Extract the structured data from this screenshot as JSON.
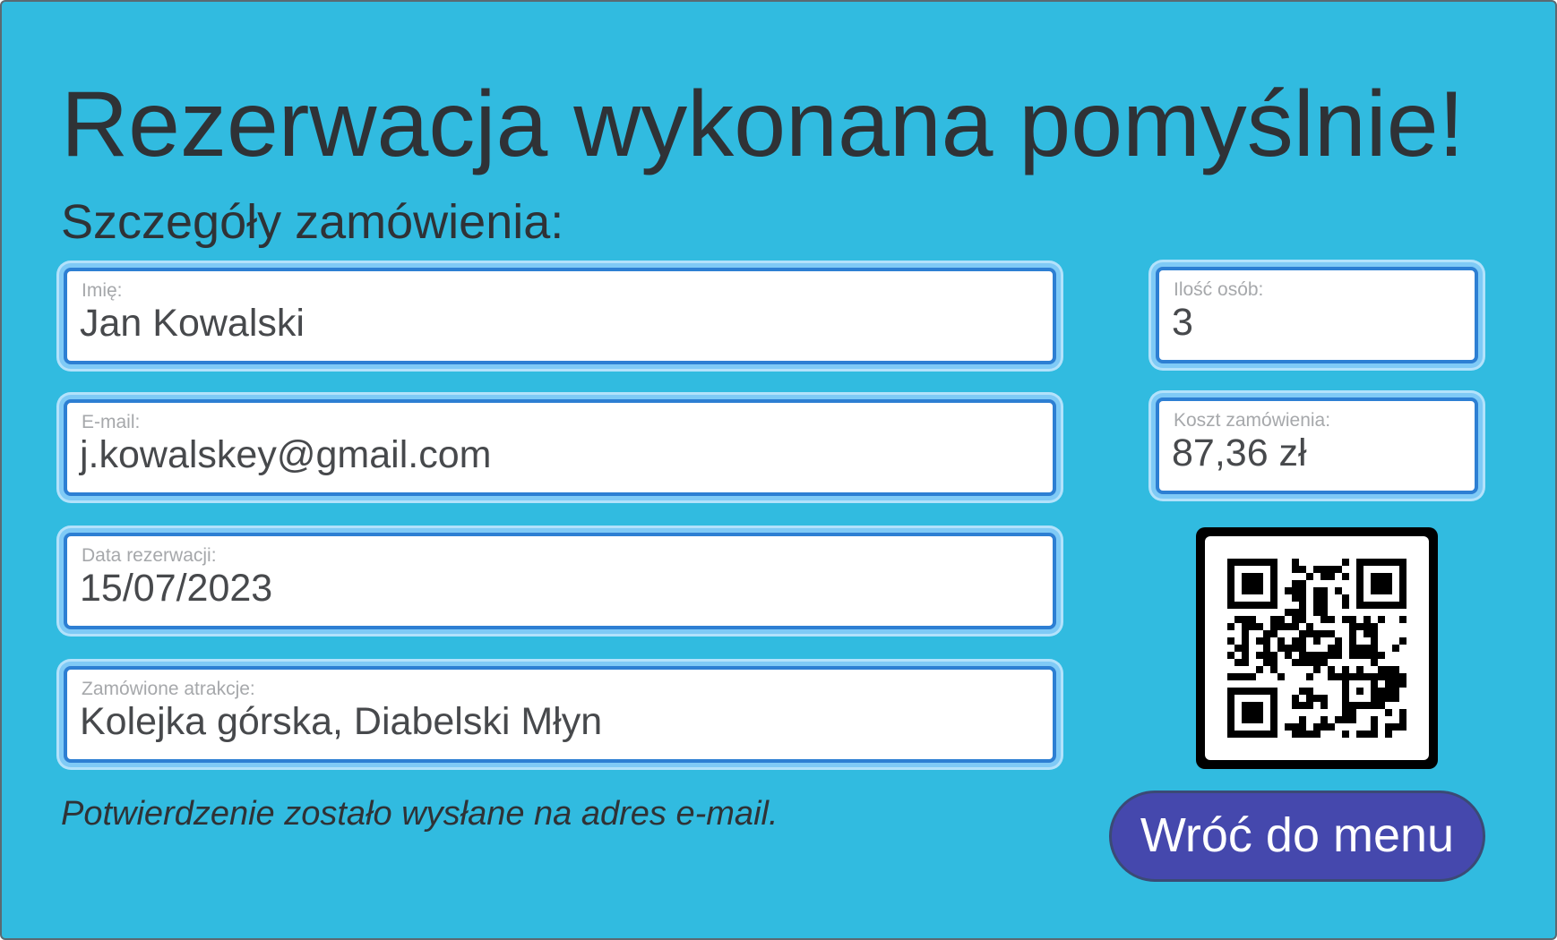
{
  "page": {
    "title": "Rezerwacja wykonana pomyślnie!",
    "subtitle": "Szczegóły zamówienia:",
    "confirmation_note": "Potwierdzenie zostało wysłane na adres e-mail."
  },
  "fields": {
    "name": {
      "label": "Imię:",
      "value": "Jan Kowalski"
    },
    "email": {
      "label": "E-mail:",
      "value": "j.kowalskey@gmail.com"
    },
    "date": {
      "label": "Data rezerwacji:",
      "value": "15/07/2023"
    },
    "attractions": {
      "label": "Zamówione atrakcje:",
      "value": "Kolejka górska, Diabelski Młyn"
    },
    "people": {
      "label": "Ilość osób:",
      "value": "3"
    },
    "cost": {
      "label": "Koszt zamówienia:",
      "value": "87,36 zł"
    }
  },
  "qr": {
    "icon": "qr-code-icon"
  },
  "back_button": {
    "label": "Wróć do menu"
  },
  "colors": {
    "background": "#31bbe0",
    "field_border": "#2d7fd3",
    "field_glow": "#7fcaf6",
    "button": "#4548ad",
    "text": "#2f3236"
  }
}
